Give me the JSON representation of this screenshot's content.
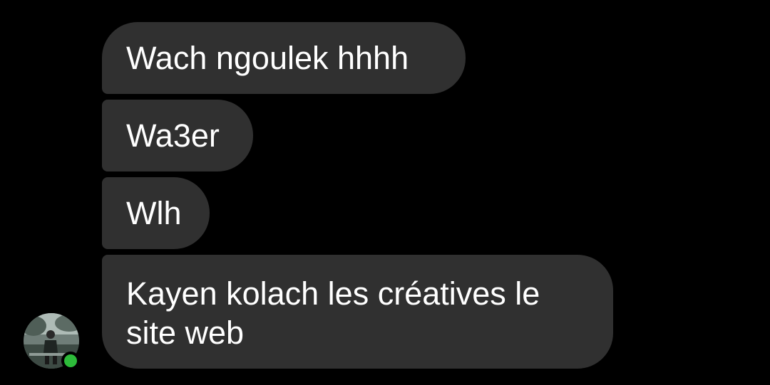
{
  "conversation": {
    "messages": [
      {
        "text": "Wach ngoulek hhhh"
      },
      {
        "text": "Wa3er"
      },
      {
        "text": "Wlh"
      },
      {
        "text": "Kayen kolach les créatives le site web"
      }
    ],
    "sender": {
      "avatar_icon": "profile-photo-icon",
      "online": true,
      "status_color": "#2dbb3a"
    }
  },
  "colors": {
    "background": "#000000",
    "bubble": "#303030",
    "text": "#ffffff"
  }
}
